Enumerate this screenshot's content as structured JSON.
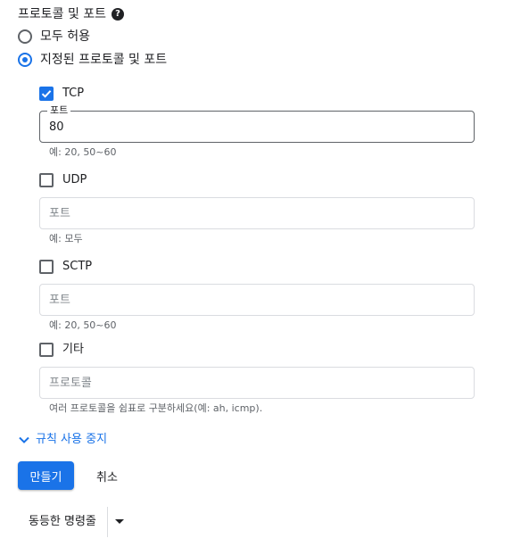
{
  "section": {
    "title": "프로토콜 및 포트",
    "help_icon": "help-circle-icon"
  },
  "radios": {
    "allow_all": {
      "label": "모두 허용",
      "checked": false
    },
    "specified": {
      "label": "지정된 프로토콜 및 포트",
      "checked": true
    }
  },
  "protocols": {
    "tcp": {
      "label": "TCP",
      "checked": true,
      "field_legend": "포트",
      "value": "80",
      "placeholder": "",
      "hint": "예: 20, 50~60"
    },
    "udp": {
      "label": "UDP",
      "checked": false,
      "value": "",
      "placeholder": "포트",
      "hint": "예: 모두"
    },
    "sctp": {
      "label": "SCTP",
      "checked": false,
      "value": "",
      "placeholder": "포트",
      "hint": "예: 20, 50~60"
    },
    "other": {
      "label": "기타",
      "checked": false,
      "value": "",
      "placeholder": "프로토콜",
      "hint": "여러 프로토콜을 쉼표로 구분하세요(예: ah, icmp)."
    }
  },
  "disable_rule_link": "규칙 사용 중지",
  "actions": {
    "create": "만들기",
    "cancel": "취소",
    "equivalent_command": "동등한 명령줄"
  },
  "colors": {
    "accent": "#1a73e8",
    "text": "#202124",
    "muted": "#5f6368",
    "border": "#dadce0"
  }
}
